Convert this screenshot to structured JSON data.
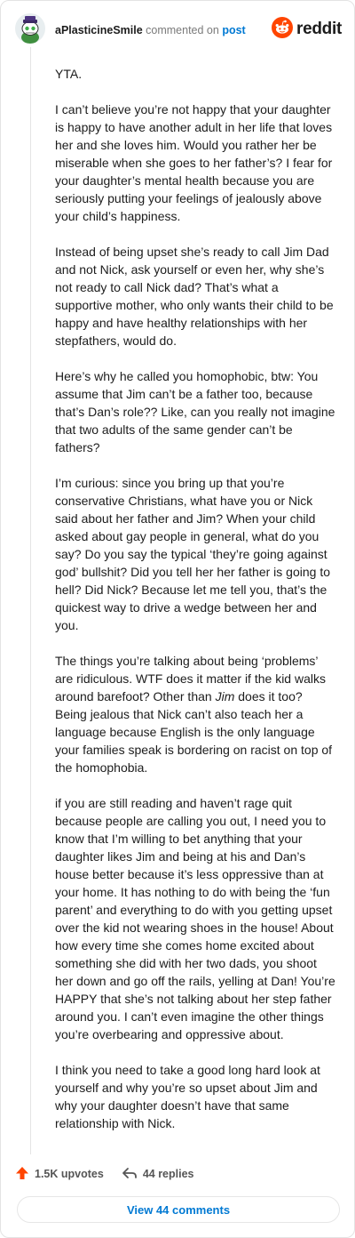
{
  "header": {
    "username": "aPlasticineSmile",
    "commented_on": "commented on",
    "post_link": "post",
    "brand": "reddit"
  },
  "comment": {
    "paragraphs": [
      "YTA.",
      "I can’t believe you’re not happy that your daughter is happy to have another adult in her life that loves her and she loves him. Would you rather her be miserable when she goes to her father’s? I fear for your daughter’s mental health because you are seriously putting your feelings of jealously above your child’s happiness.",
      "Instead of being upset she’s ready to call Jim Dad and not Nick, ask yourself or even her, why she’s not ready to call Nick dad? That’s what a supportive mother, who only wants their child to be happy and have healthy relationships with her stepfathers, would do.",
      "Here’s why he called you homophobic, btw: You assume that Jim can’t be a father too, because that’s Dan’s role?? Like, can you really not imagine that two adults of the same gender can’t be fathers?",
      "I’m curious: since you bring up that you’re conservative Christians, what have you or Nick said about her father and Jim? When your child asked about gay people in general, what do you say? Do you say the typical ‘they’re going against god’ bullshit? Did you tell her her father is going to hell? Did Nick? Because let me tell you, that’s the quickest way to drive a wedge between her and you.",
      "if you are still reading and haven’t rage quit because people are calling you out, I need you to know that I’m willing to bet anything that your daughter likes Jim and being at his and Dan’s house better because it’s less oppressive than at your home. It has nothing to do with being the ‘fun parent’ and everything to do with you getting upset over the kid not wearing shoes in the house! About how every time she comes home excited about something she did with her two dads, you shoot her down and go off the rails, yelling at Dan! You’re HAPPY that she’s not talking about her step father around you. I can’t even imagine the other things you’re overbearing and oppressive about.",
      "I think you need to take a good long hard look at yourself and why you’re so upset about Jim and why your daughter doesn’t have that same relationship with Nick."
    ],
    "paragraph_6": {
      "before": "The things you’re talking about being ‘problems’ are ridiculous. WTF does it matter if the kid walks around barefoot? Other than ",
      "italic": "Jim",
      "after": " does it too? Being jealous that Nick can’t also teach her a language because English is the only language your families speak is bordering on racist on top of the homophobia."
    }
  },
  "footer": {
    "upvotes": "1.5K upvotes",
    "replies": "44 replies",
    "view_comments": "View 44 comments"
  },
  "colors": {
    "reddit_orange": "#ff4500",
    "link_blue": "#0079d3",
    "upvote_red": "#ff4500"
  },
  "icons": [
    "avatar",
    "reddit-logo-icon",
    "upvote-arrow-icon",
    "reply-arrow-icon"
  ]
}
